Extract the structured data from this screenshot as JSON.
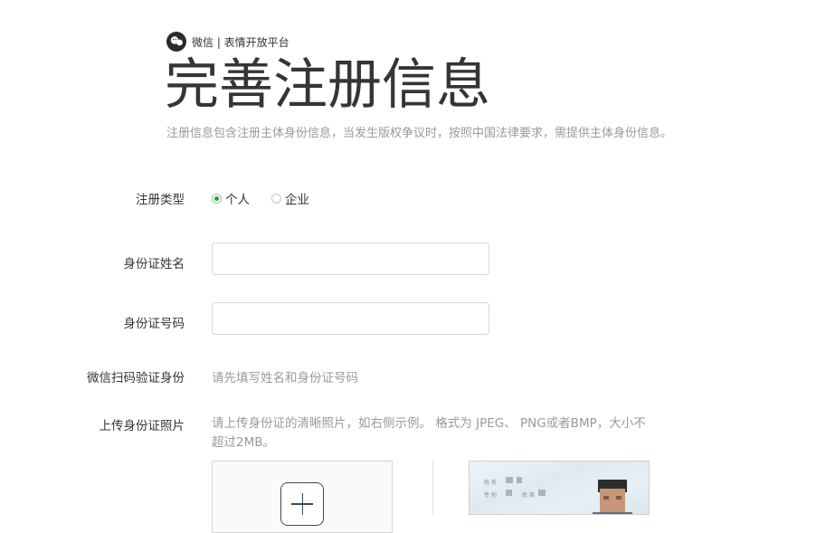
{
  "brand": {
    "name": "微信 | 表情开放平台"
  },
  "page": {
    "title": "完善注册信息",
    "description": "注册信息包含注册主体身份信息，当发生版权争议时，按照中国法律要求，需提供主体身份信息。"
  },
  "form": {
    "type_label": "注册类型",
    "type_options": [
      {
        "label": "个人",
        "checked": true
      },
      {
        "label": "企业",
        "checked": false
      }
    ],
    "name_label": "身份证姓名",
    "name_value": "",
    "id_label": "身份证号码",
    "id_value": "",
    "scan_label": "微信扫码验证身份",
    "scan_hint": "请先填写姓名和身份证号码",
    "upload_label": "上传身份证照片",
    "upload_hint": "请上传身份证的清晰照片，如右侧示例。 格式为 JPEG、 PNG或者BMP，大小不超过2MB。"
  },
  "sample_card": {
    "name_label": "姓 名",
    "gender_label": "性 别",
    "nation_label": "民 族"
  },
  "colors": {
    "accent": "#1aad19",
    "title": "#353535",
    "muted": "#9a9a9a"
  }
}
